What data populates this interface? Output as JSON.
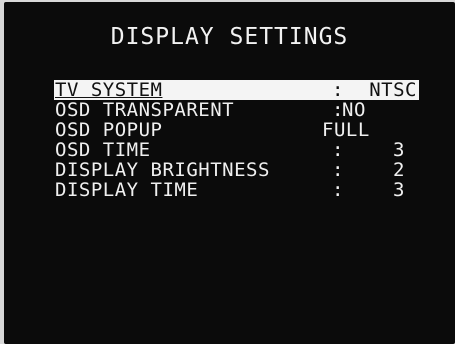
{
  "title": "DISPLAY SETTINGS",
  "menu": {
    "items": [
      {
        "label": "TV SYSTEM",
        "separator": ":",
        "value": "NTSC",
        "selected": true
      },
      {
        "label": "OSD TRANSPARENT",
        "separator": ":",
        "value": "NO",
        "selected": false
      },
      {
        "label": "OSD POPUP",
        "separator": "",
        "value": "FULL",
        "selected": false
      },
      {
        "label": "OSD TIME",
        "separator": ":",
        "value": "3",
        "selected": false
      },
      {
        "label": "DISPLAY BRIGHTNESS",
        "separator": ":",
        "value": "2",
        "selected": false
      },
      {
        "label": "DISPLAY TIME",
        "separator": ":",
        "value": "3",
        "selected": false
      }
    ]
  },
  "colors": {
    "screen_background": "#0b0b0b",
    "text": "#f0f0f0",
    "highlight_background": "#f4f4f4",
    "highlight_text": "#111111",
    "bezel": "#d9d9d9"
  }
}
